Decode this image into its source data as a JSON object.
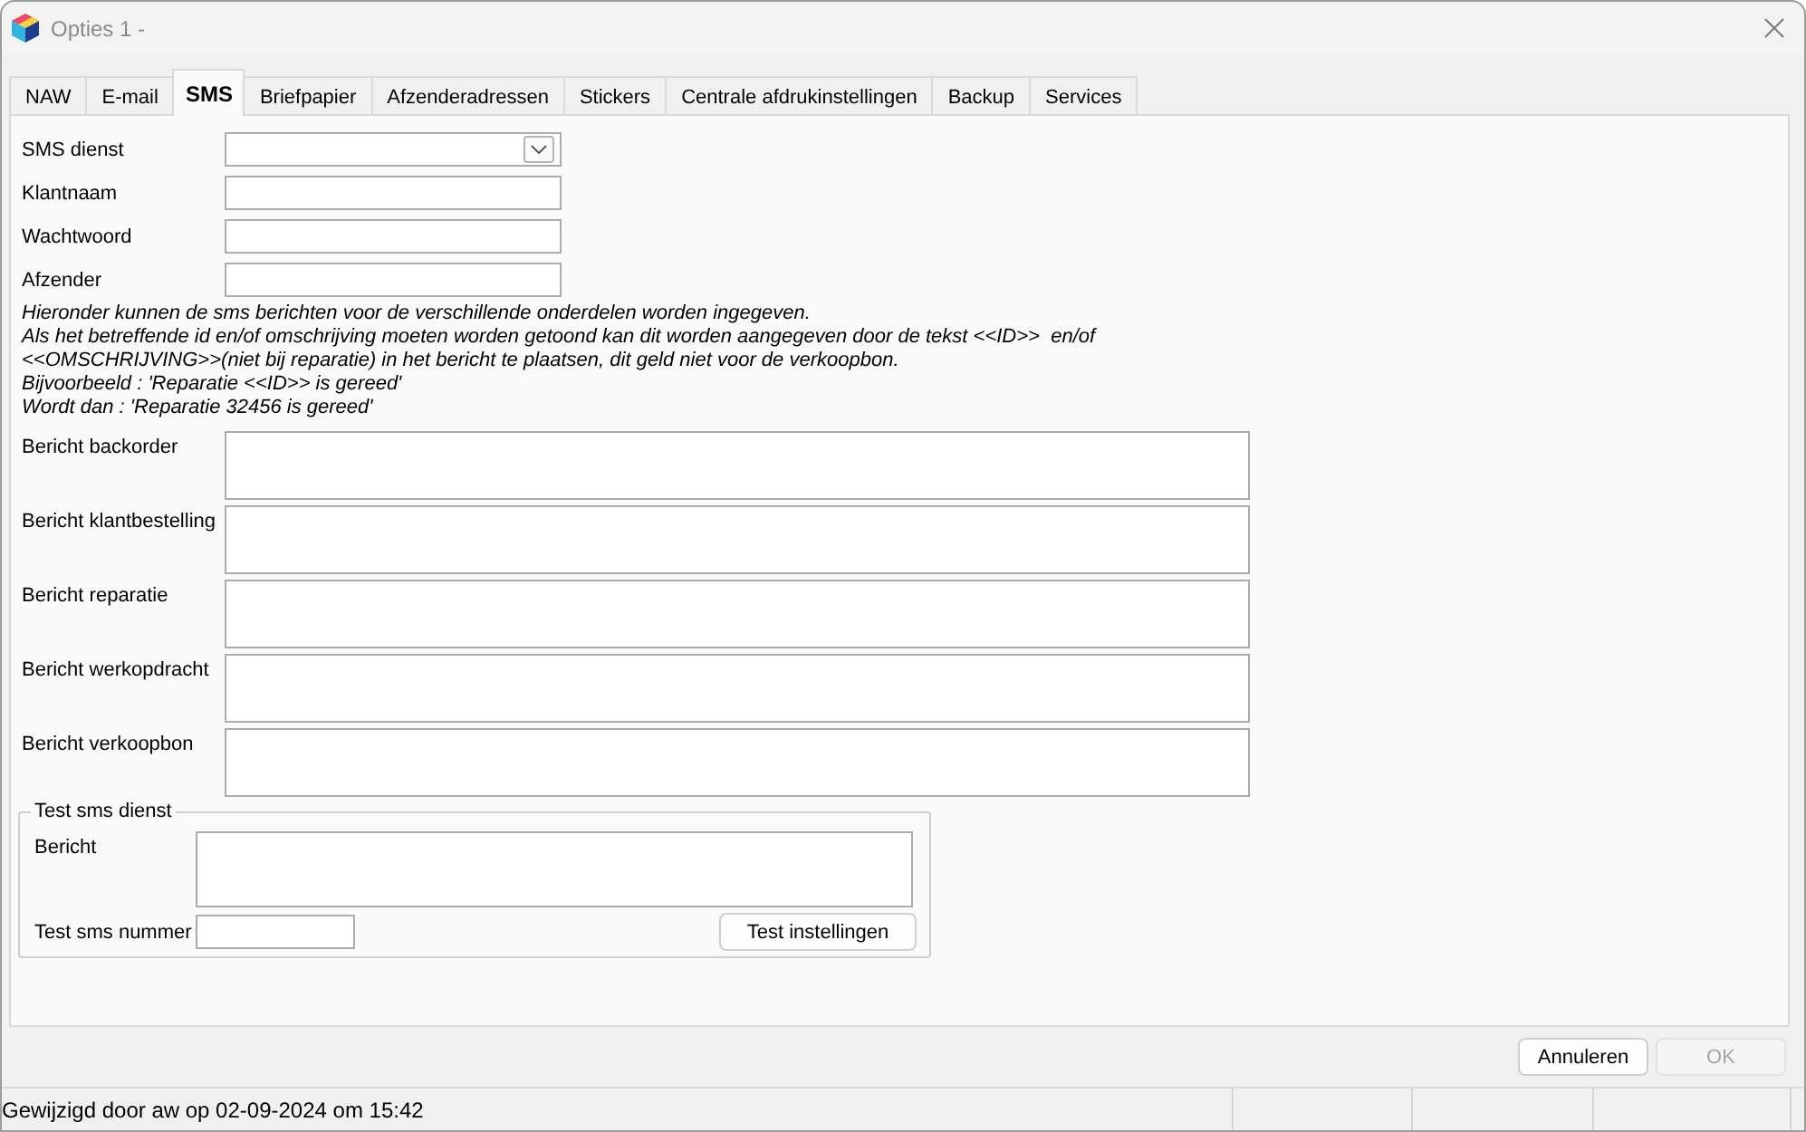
{
  "window": {
    "title": "Opties 1 -"
  },
  "tabs": [
    {
      "label": "NAW",
      "selected": false
    },
    {
      "label": "E-mail",
      "selected": false
    },
    {
      "label": "SMS",
      "selected": true
    },
    {
      "label": "Briefpapier",
      "selected": false
    },
    {
      "label": "Afzenderadressen",
      "selected": false
    },
    {
      "label": "Stickers",
      "selected": false
    },
    {
      "label": "Centrale afdrukinstellingen",
      "selected": false
    },
    {
      "label": "Backup",
      "selected": false
    },
    {
      "label": "Services",
      "selected": false
    }
  ],
  "settings_fields": [
    {
      "label": "SMS dienst",
      "kind": "dropdown"
    },
    {
      "label": "Klantnaam",
      "kind": "text"
    },
    {
      "label": "Wachtwoord",
      "kind": "text"
    },
    {
      "label": "Afzender",
      "kind": "text"
    }
  ],
  "instructions": [
    "Hieronder kunnen de sms berichten voor de verschillende onderdelen worden ingegeven.",
    "Als het betreffende id en/of omschrijving moeten worden getoond kan dit worden aangegeven door de tekst <<ID>>  en/of",
    "<<OMSCHRIJVING>>(niet bij reparatie) in het bericht te plaatsen, dit geld niet voor de verkoopbon.",
    "Bijvoorbeeld : 'Reparatie <<ID>> is gereed'",
    "Wordt dan : 'Reparatie 32456 is gereed'"
  ],
  "message_fields": [
    {
      "label": "Bericht backorder"
    },
    {
      "label": "Bericht klantbestelling"
    },
    {
      "label": "Bericht reparatie"
    },
    {
      "label": "Bericht werkopdracht"
    },
    {
      "label": "Bericht verkoopbon"
    }
  ],
  "test_group": {
    "title": "Test sms dienst",
    "message_label": "Bericht",
    "number_label": "Test sms nummer",
    "button": "Test instellingen"
  },
  "footer_buttons": [
    {
      "label": "Annuleren",
      "disabled": false
    },
    {
      "label": "OK",
      "disabled": true
    }
  ],
  "status_bar": {
    "text": "Gewijzigd door aw op 02-09-2024 om 15:42"
  }
}
